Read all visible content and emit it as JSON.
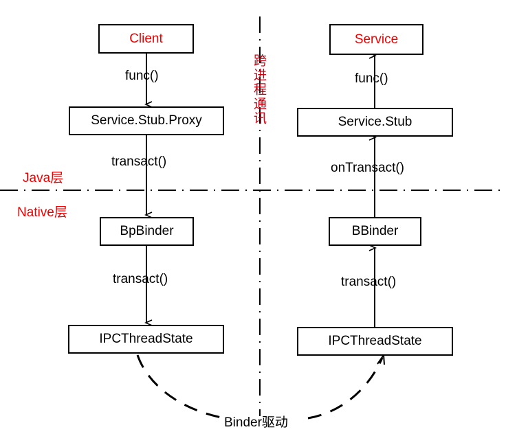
{
  "diagram": {
    "title": "Android Binder IPC architecture",
    "colors": {
      "accent_red": "#ee0000",
      "vertical_divider_red": "#cc0011",
      "stroke_black": "#000000",
      "background": "#ffffff"
    },
    "boxes": [
      {
        "id": "client",
        "label": "Client",
        "color": "#ee0000",
        "side": "left"
      },
      {
        "id": "service",
        "label": "Service",
        "color": "#ee0000",
        "side": "right"
      },
      {
        "id": "stub_proxy",
        "label": "Service.Stub.Proxy",
        "color": "#000000",
        "side": "left"
      },
      {
        "id": "stub",
        "label": "Service.Stub",
        "color": "#000000",
        "side": "right"
      },
      {
        "id": "bpbinder",
        "label": "BpBinder",
        "color": "#000000",
        "side": "left"
      },
      {
        "id": "bbinder",
        "label": "BBinder",
        "color": "#000000",
        "side": "right"
      },
      {
        "id": "ipc_left",
        "label": "IPCThreadState",
        "color": "#000000",
        "side": "left"
      },
      {
        "id": "ipc_right",
        "label": "IPCThreadState",
        "color": "#000000",
        "side": "right"
      }
    ],
    "edge_labels": [
      {
        "id": "client_to_proxy",
        "label": "func()",
        "side": "left"
      },
      {
        "id": "proxy_to_bpbinder",
        "label": "transact()",
        "side": "left"
      },
      {
        "id": "bpbinder_to_ipc",
        "label": "transact()",
        "side": "left"
      },
      {
        "id": "stub_to_service",
        "label": "func()",
        "side": "right"
      },
      {
        "id": "bbinder_to_stub",
        "label": "onTransact()",
        "side": "right"
      },
      {
        "id": "ipc_to_bbinder",
        "label": "transact()",
        "side": "right"
      }
    ],
    "layer_labels": [
      {
        "id": "java_layer",
        "label": "Java层"
      },
      {
        "id": "native_layer",
        "label": "Native层"
      }
    ],
    "divider_vertical_label": "跨进程通讯",
    "driver_label": "Binder驱动"
  }
}
